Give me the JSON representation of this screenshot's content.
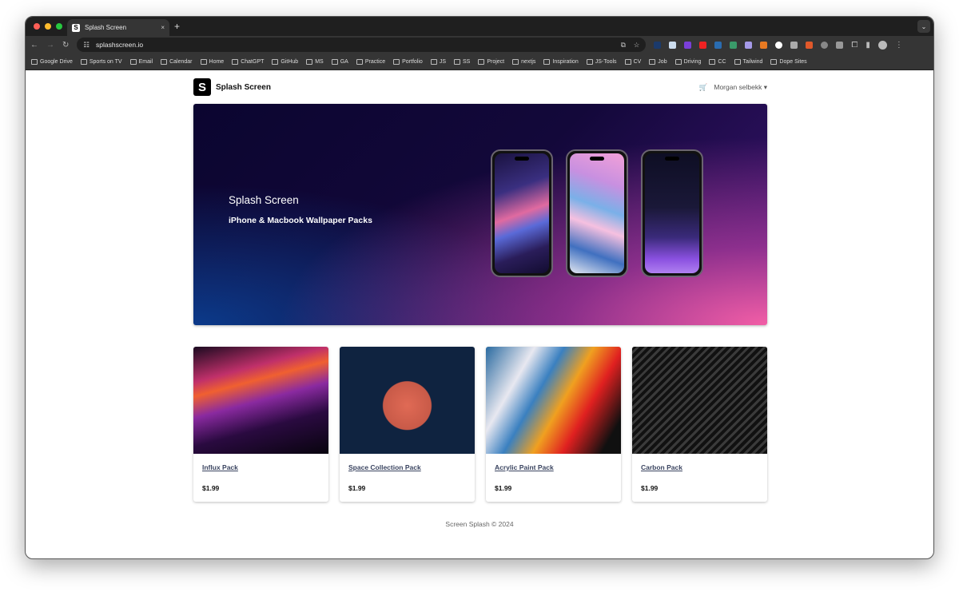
{
  "browser": {
    "tab_title": "Splash Screen",
    "tab_close": "×",
    "new_tab": "+",
    "url": "splashscreen.io",
    "bookmarks": [
      "Google Drive",
      "Sports on TV",
      "Email",
      "Calendar",
      "Home",
      "ChatGPT",
      "GitHub",
      "MS",
      "GA",
      "Practice",
      "Portfolio",
      "JS",
      "SS",
      "Project",
      "nextjs",
      "Inspiration",
      "JS-Tools",
      "CV",
      "Job",
      "Driving",
      "CC",
      "Tailwind",
      "Dope Sites"
    ]
  },
  "header": {
    "logo": "S",
    "brand": "Splash Screen",
    "user": "Morgan selbekk ▾",
    "cart_icon": "cart-icon"
  },
  "hero": {
    "title": "Splash Screen",
    "subtitle": "iPhone & Macbook Wallpaper Packs"
  },
  "products": [
    {
      "name": "Influx Pack",
      "price": "$1.99"
    },
    {
      "name": "Space Collection Pack",
      "price": "$1.99"
    },
    {
      "name": "Acrylic Paint Pack",
      "price": "$1.99"
    },
    {
      "name": "Carbon Pack",
      "price": "$1.99"
    }
  ],
  "footer": "Screen Splash © 2024"
}
